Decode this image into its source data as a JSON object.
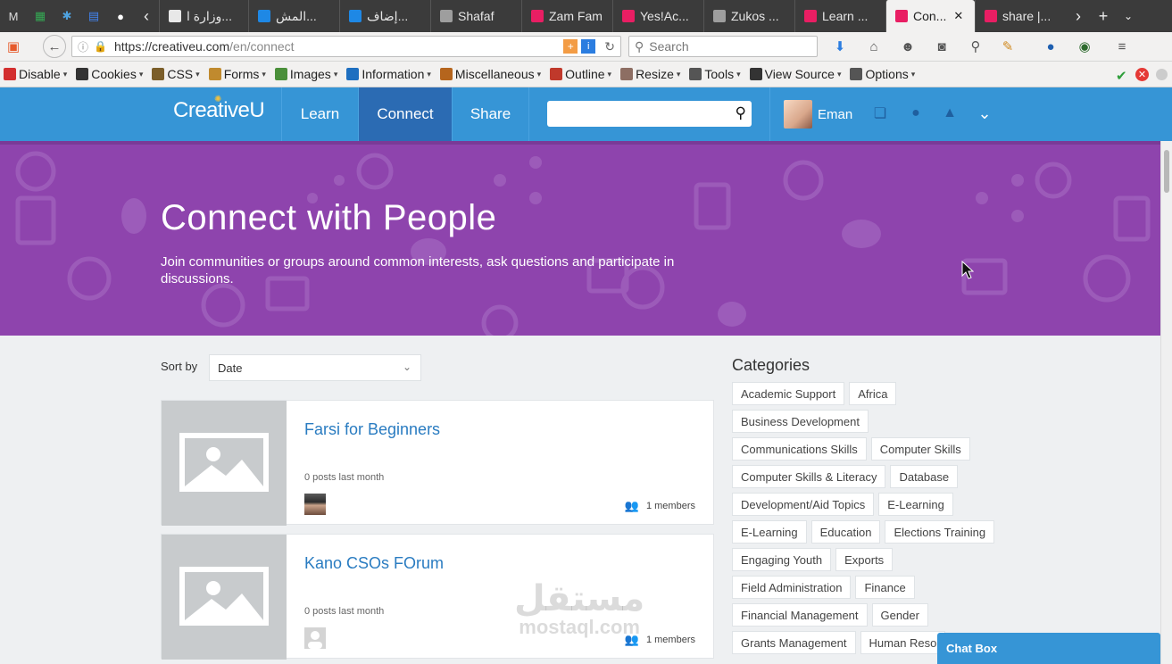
{
  "browser": {
    "tabs": [
      {
        "label": "وزارة ا...",
        "color": "#e8e8e8"
      },
      {
        "label": "المش...",
        "color": "#1e88e5"
      },
      {
        "label": "إضاف...",
        "color": "#1e88e5"
      },
      {
        "label": "Shafaf",
        "color": "#9e9e9e"
      },
      {
        "label": "Zam Fam",
        "color": "#e91e63"
      },
      {
        "label": "Yes!Ac...",
        "color": "#e91e63"
      },
      {
        "label": "Zukos ...",
        "color": "#9e9e9e"
      },
      {
        "label": "Learn ...",
        "color": "#e91e63"
      },
      {
        "label": "Con...",
        "color": "#e91e63"
      },
      {
        "label": "share |...",
        "color": "#e91e63"
      }
    ],
    "url_host": "https://creativeu.com",
    "url_path": "/en/connect",
    "search_placeholder": "Search"
  },
  "devbar": [
    {
      "label": "Disable",
      "color": "#d32f2f"
    },
    {
      "label": "Cookies",
      "color": "#333333"
    },
    {
      "label": "CSS",
      "color": "#7b5e2a"
    },
    {
      "label": "Forms",
      "color": "#c08a2e"
    },
    {
      "label": "Images",
      "color": "#4a8f3a"
    },
    {
      "label": "Information",
      "color": "#1e6fc0"
    },
    {
      "label": "Miscellaneous",
      "color": "#b5651d"
    },
    {
      "label": "Outline",
      "color": "#c0392b"
    },
    {
      "label": "Resize",
      "color": "#8d6e63"
    },
    {
      "label": "Tools",
      "color": "#555555"
    },
    {
      "label": "View Source",
      "color": "#333333"
    },
    {
      "label": "Options",
      "color": "#555555"
    }
  ],
  "site": {
    "logo": "CreativeU",
    "nav": [
      "Learn",
      "Connect",
      "Share"
    ],
    "user_name": "Eman"
  },
  "hero": {
    "title": "Connect with People",
    "subtitle": "Join communities or groups around common interests, ask questions and participate in discussions."
  },
  "sort": {
    "label": "Sort by",
    "value": "Date"
  },
  "groups": [
    {
      "title": "Farsi for Beginners",
      "posts": "0 posts last month",
      "members": "1 members"
    },
    {
      "title": "Kano CSOs FOrum",
      "posts": "0 posts last month",
      "members": "1 members"
    }
  ],
  "categories": {
    "title": "Categories",
    "items": [
      "Academic Support",
      "Africa",
      "Business Development",
      "Communications Skills",
      "Computer Skills",
      "Computer Skills & Literacy",
      "Database",
      "Development/Aid Topics",
      "E-Learning",
      "E-Learning",
      "Education",
      "Elections Training",
      "Engaging Youth",
      "Exports",
      "Field Administration",
      "Finance",
      "Financial Management",
      "Gender",
      "Grants Management",
      "Human Reso"
    ]
  },
  "chatbox": "Chat Box",
  "watermark": {
    "arabic": "مستقل",
    "latin": "mostaql.com"
  }
}
